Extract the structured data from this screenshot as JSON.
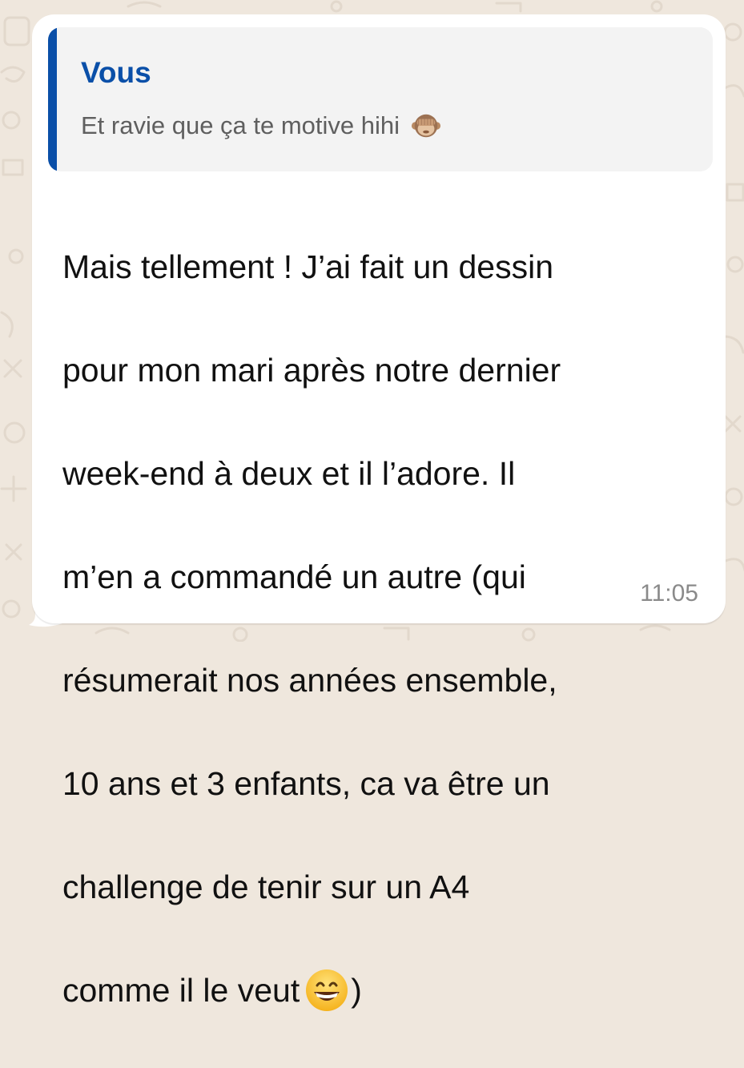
{
  "quote": {
    "author": "Vous",
    "text": "Et ravie que ça te motive hihi",
    "emoji_icon": "see-no-evil-monkey-icon"
  },
  "message": {
    "lines": [
      "Mais tellement ! J’ai fait un dessin",
      "pour mon mari après notre dernier",
      "week-end à deux et il l’adore. Il",
      "m’en a commandé un autre (qui",
      "résumerait nos années ensemble,",
      "10 ans et 3 enfants, ca va être un",
      "challenge de tenir sur un A4"
    ],
    "last_line_before": "comme il le veut",
    "last_line_emoji_icon": "grinning-face-icon",
    "last_line_after": ")",
    "time": "11:05"
  },
  "colors": {
    "background": "#efe7dd",
    "bubble": "#ffffff",
    "quote_background": "#f3f3f3",
    "quote_accent": "#0a4fa8",
    "quote_text": "#5f5f5f",
    "message_text": "#111111",
    "timestamp": "#8a8a8a"
  }
}
